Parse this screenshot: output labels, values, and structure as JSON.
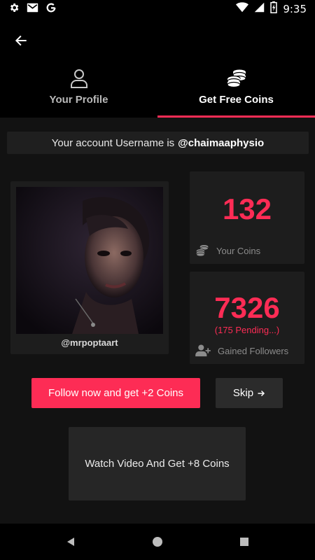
{
  "status_bar": {
    "time": "9:35",
    "left_icons": [
      "settings-icon",
      "gmail-icon",
      "google-icon"
    ],
    "right_icons": [
      "wifi-icon",
      "signal-icon",
      "battery-charging-icon"
    ]
  },
  "tabs": [
    {
      "label": "Your Profile",
      "icon": "person-icon",
      "active": false
    },
    {
      "label": "Get Free Coins",
      "icon": "coins-icon",
      "active": true
    }
  ],
  "banner": {
    "prefix": "Your account Username is",
    "username": "@chaimaaphysio"
  },
  "profile": {
    "username": "@mrpoptaart"
  },
  "stats": {
    "coins_value": "132",
    "coins_label": "Your Coins",
    "followers_value": "7326",
    "followers_pending": "(175 Pending...)",
    "followers_label": "Gained Followers"
  },
  "buttons": {
    "follow": "Follow now and get +2 Coins",
    "skip": "Skip",
    "watch": "Watch Video And Get +8 Coins"
  },
  "colors": {
    "accent": "#fd2c55",
    "background": "#121212",
    "card": "#1d1d1d"
  }
}
